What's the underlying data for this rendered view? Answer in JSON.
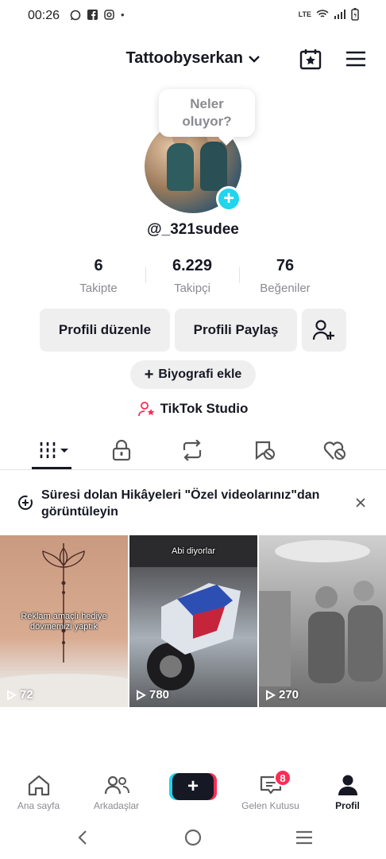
{
  "status_bar": {
    "time": "00:26",
    "network": "LTE"
  },
  "header": {
    "username": "Tattoobyserkan"
  },
  "avatar": {
    "bubble_line1": "Neler",
    "bubble_line2": "oluyor?"
  },
  "profile": {
    "handle": "@_321sudee"
  },
  "stats": [
    {
      "value": "6",
      "label": "Takipte"
    },
    {
      "value": "6.229",
      "label": "Takipçi"
    },
    {
      "value": "76",
      "label": "Beğeniler"
    }
  ],
  "actions": {
    "edit_profile": "Profili düzenle",
    "share_profile": "Profili Paylaş",
    "add_bio": "Biyografi ekle",
    "studio": "TikTok Studio"
  },
  "notice": {
    "text": "Süresi dolan Hikâyeleri \"Özel videolarınız\"dan görüntüleyin"
  },
  "videos": [
    {
      "caption": "Reklam amaçlı hediye dövmemizi yaptık",
      "views": "72"
    },
    {
      "caption": "Abi diyorlar",
      "views": "780"
    },
    {
      "caption": "",
      "views": "270"
    }
  ],
  "bottom_nav": {
    "home": "Ana sayfa",
    "friends": "Arkadaşlar",
    "inbox": "Gelen Kutusu",
    "inbox_badge": "8",
    "profile": "Profil"
  },
  "colors": {
    "accent_cyan": "#20d5ec",
    "accent_red": "#fe2c55",
    "text": "#161823",
    "muted": "#8a8b91",
    "button_bg": "#efeff0"
  }
}
